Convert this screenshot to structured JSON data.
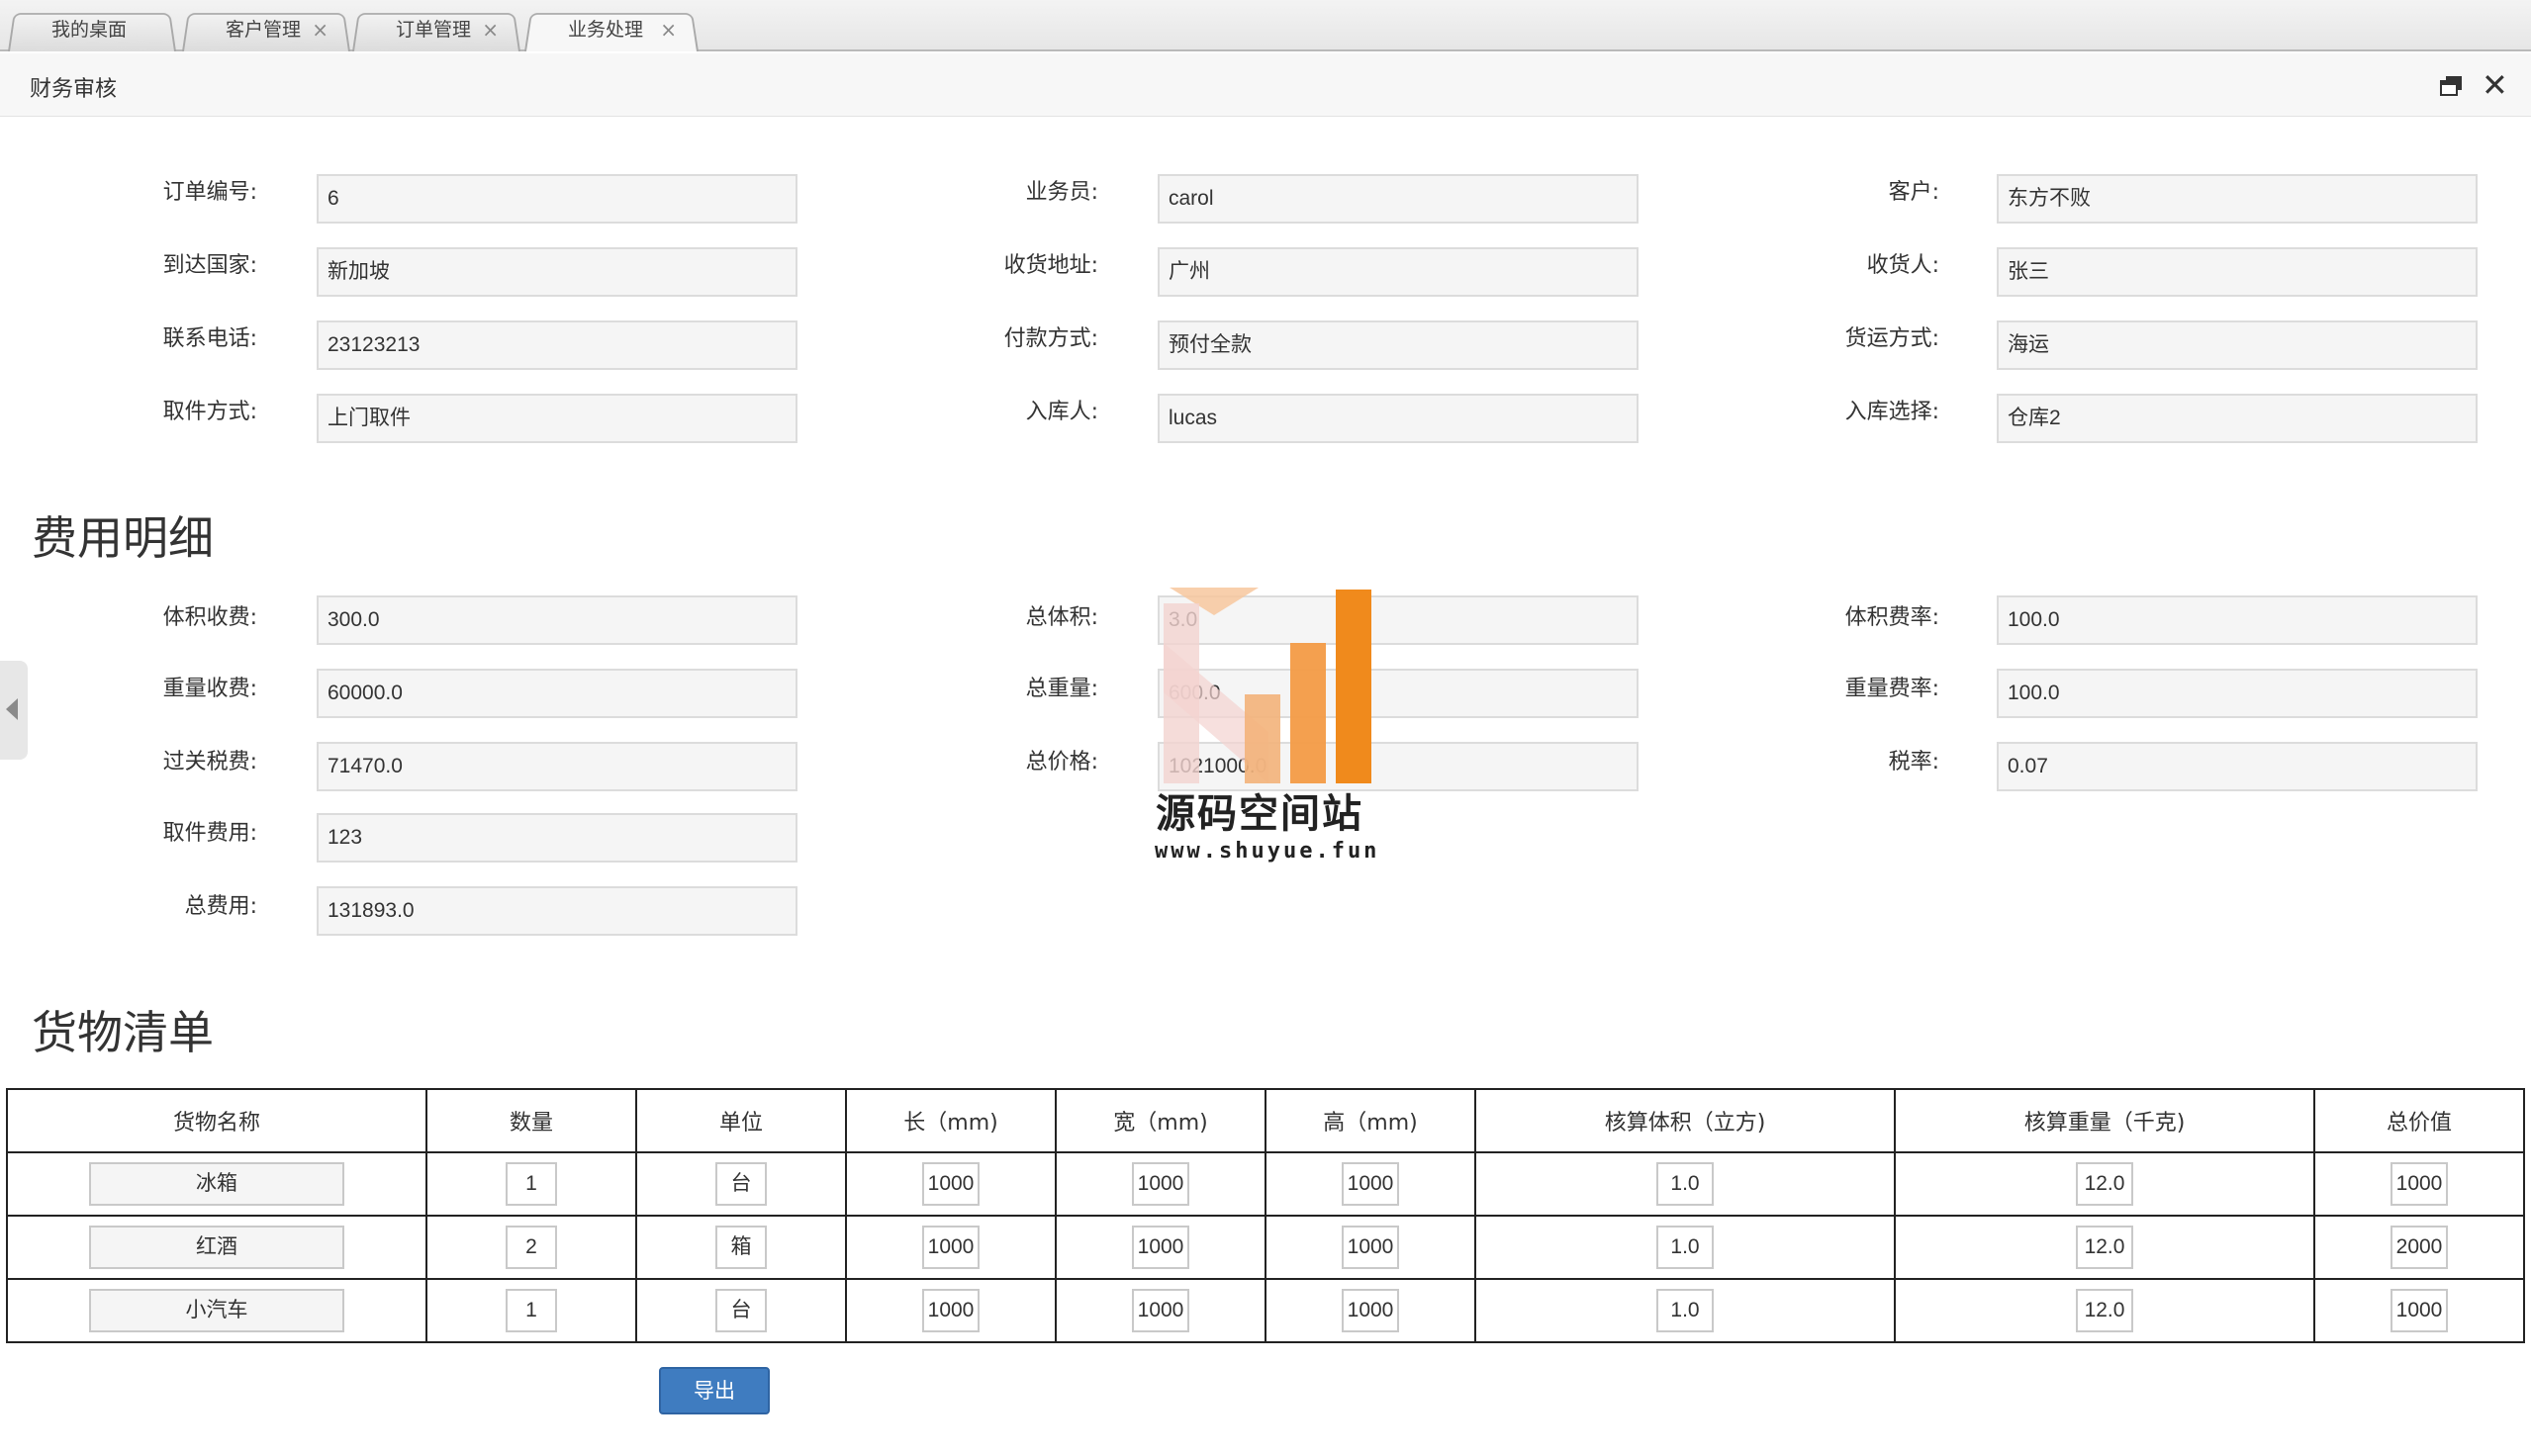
{
  "tabs": [
    {
      "label": "我的桌面",
      "closable": false
    },
    {
      "label": "客户管理",
      "closable": true
    },
    {
      "label": "订单管理",
      "closable": true
    },
    {
      "label": "业务处理",
      "closable": true,
      "active": true
    }
  ],
  "tab_close_glyph": "×",
  "panel": {
    "title": "财务审核",
    "close_glyph": "✕"
  },
  "order": {
    "order_no": {
      "label": "订单编号:",
      "value": "6"
    },
    "salesman": {
      "label": "业务员:",
      "value": "carol"
    },
    "customer": {
      "label": "客户:",
      "value": "东方不败"
    },
    "country": {
      "label": "到达国家:",
      "value": "新加坡"
    },
    "address": {
      "label": "收货地址:",
      "value": "广州"
    },
    "receiver": {
      "label": "收货人:",
      "value": "张三"
    },
    "phone": {
      "label": "联系电话:",
      "value": "23123213"
    },
    "payment": {
      "label": "付款方式:",
      "value": "预付全款"
    },
    "shipping": {
      "label": "货运方式:",
      "value": "海运"
    },
    "pickup": {
      "label": "取件方式:",
      "value": "上门取件"
    },
    "stocker": {
      "label": "入库人:",
      "value": "lucas"
    },
    "warehouse": {
      "label": "入库选择:",
      "value": "仓库2"
    }
  },
  "fees": {
    "title": "费用明细",
    "volume_fee": {
      "label": "体积收费:",
      "value": "300.0"
    },
    "total_volume": {
      "label": "总体积:",
      "value": "3.0"
    },
    "volume_rate": {
      "label": "体积费率:",
      "value": "100.0"
    },
    "weight_fee": {
      "label": "重量收费:",
      "value": "60000.0"
    },
    "total_weight": {
      "label": "总重量:",
      "value": "600.0"
    },
    "weight_rate": {
      "label": "重量费率:",
      "value": "100.0"
    },
    "customs_tax": {
      "label": "过关税费:",
      "value": "71470.0"
    },
    "total_price": {
      "label": "总价格:",
      "value": "1021000.0"
    },
    "tax_rate": {
      "label": "税率:",
      "value": "0.07"
    },
    "pickup_fee": {
      "label": "取件费用:",
      "value": "123"
    },
    "total_fee": {
      "label": "总费用:",
      "value": "131893.0"
    }
  },
  "goods": {
    "title": "货物清单",
    "headers": [
      "货物名称",
      "数量",
      "单位",
      "长（mm)",
      "宽（mm)",
      "高（mm)",
      "核算体积（立方)",
      "核算重量（千克)",
      "总价值"
    ],
    "rows": [
      [
        "冰箱",
        "1",
        "台",
        "1000",
        "1000",
        "1000",
        "1.0",
        "12.0",
        "1000"
      ],
      [
        "红酒",
        "2",
        "箱",
        "1000",
        "1000",
        "1000",
        "1.0",
        "12.0",
        "2000"
      ],
      [
        "小汽车",
        "1",
        "台",
        "1000",
        "1000",
        "1000",
        "1.0",
        "12.0",
        "1000"
      ]
    ]
  },
  "export_label": "导出",
  "watermark": {
    "text": "源码空间站",
    "url": "www.shuyue.fun"
  }
}
